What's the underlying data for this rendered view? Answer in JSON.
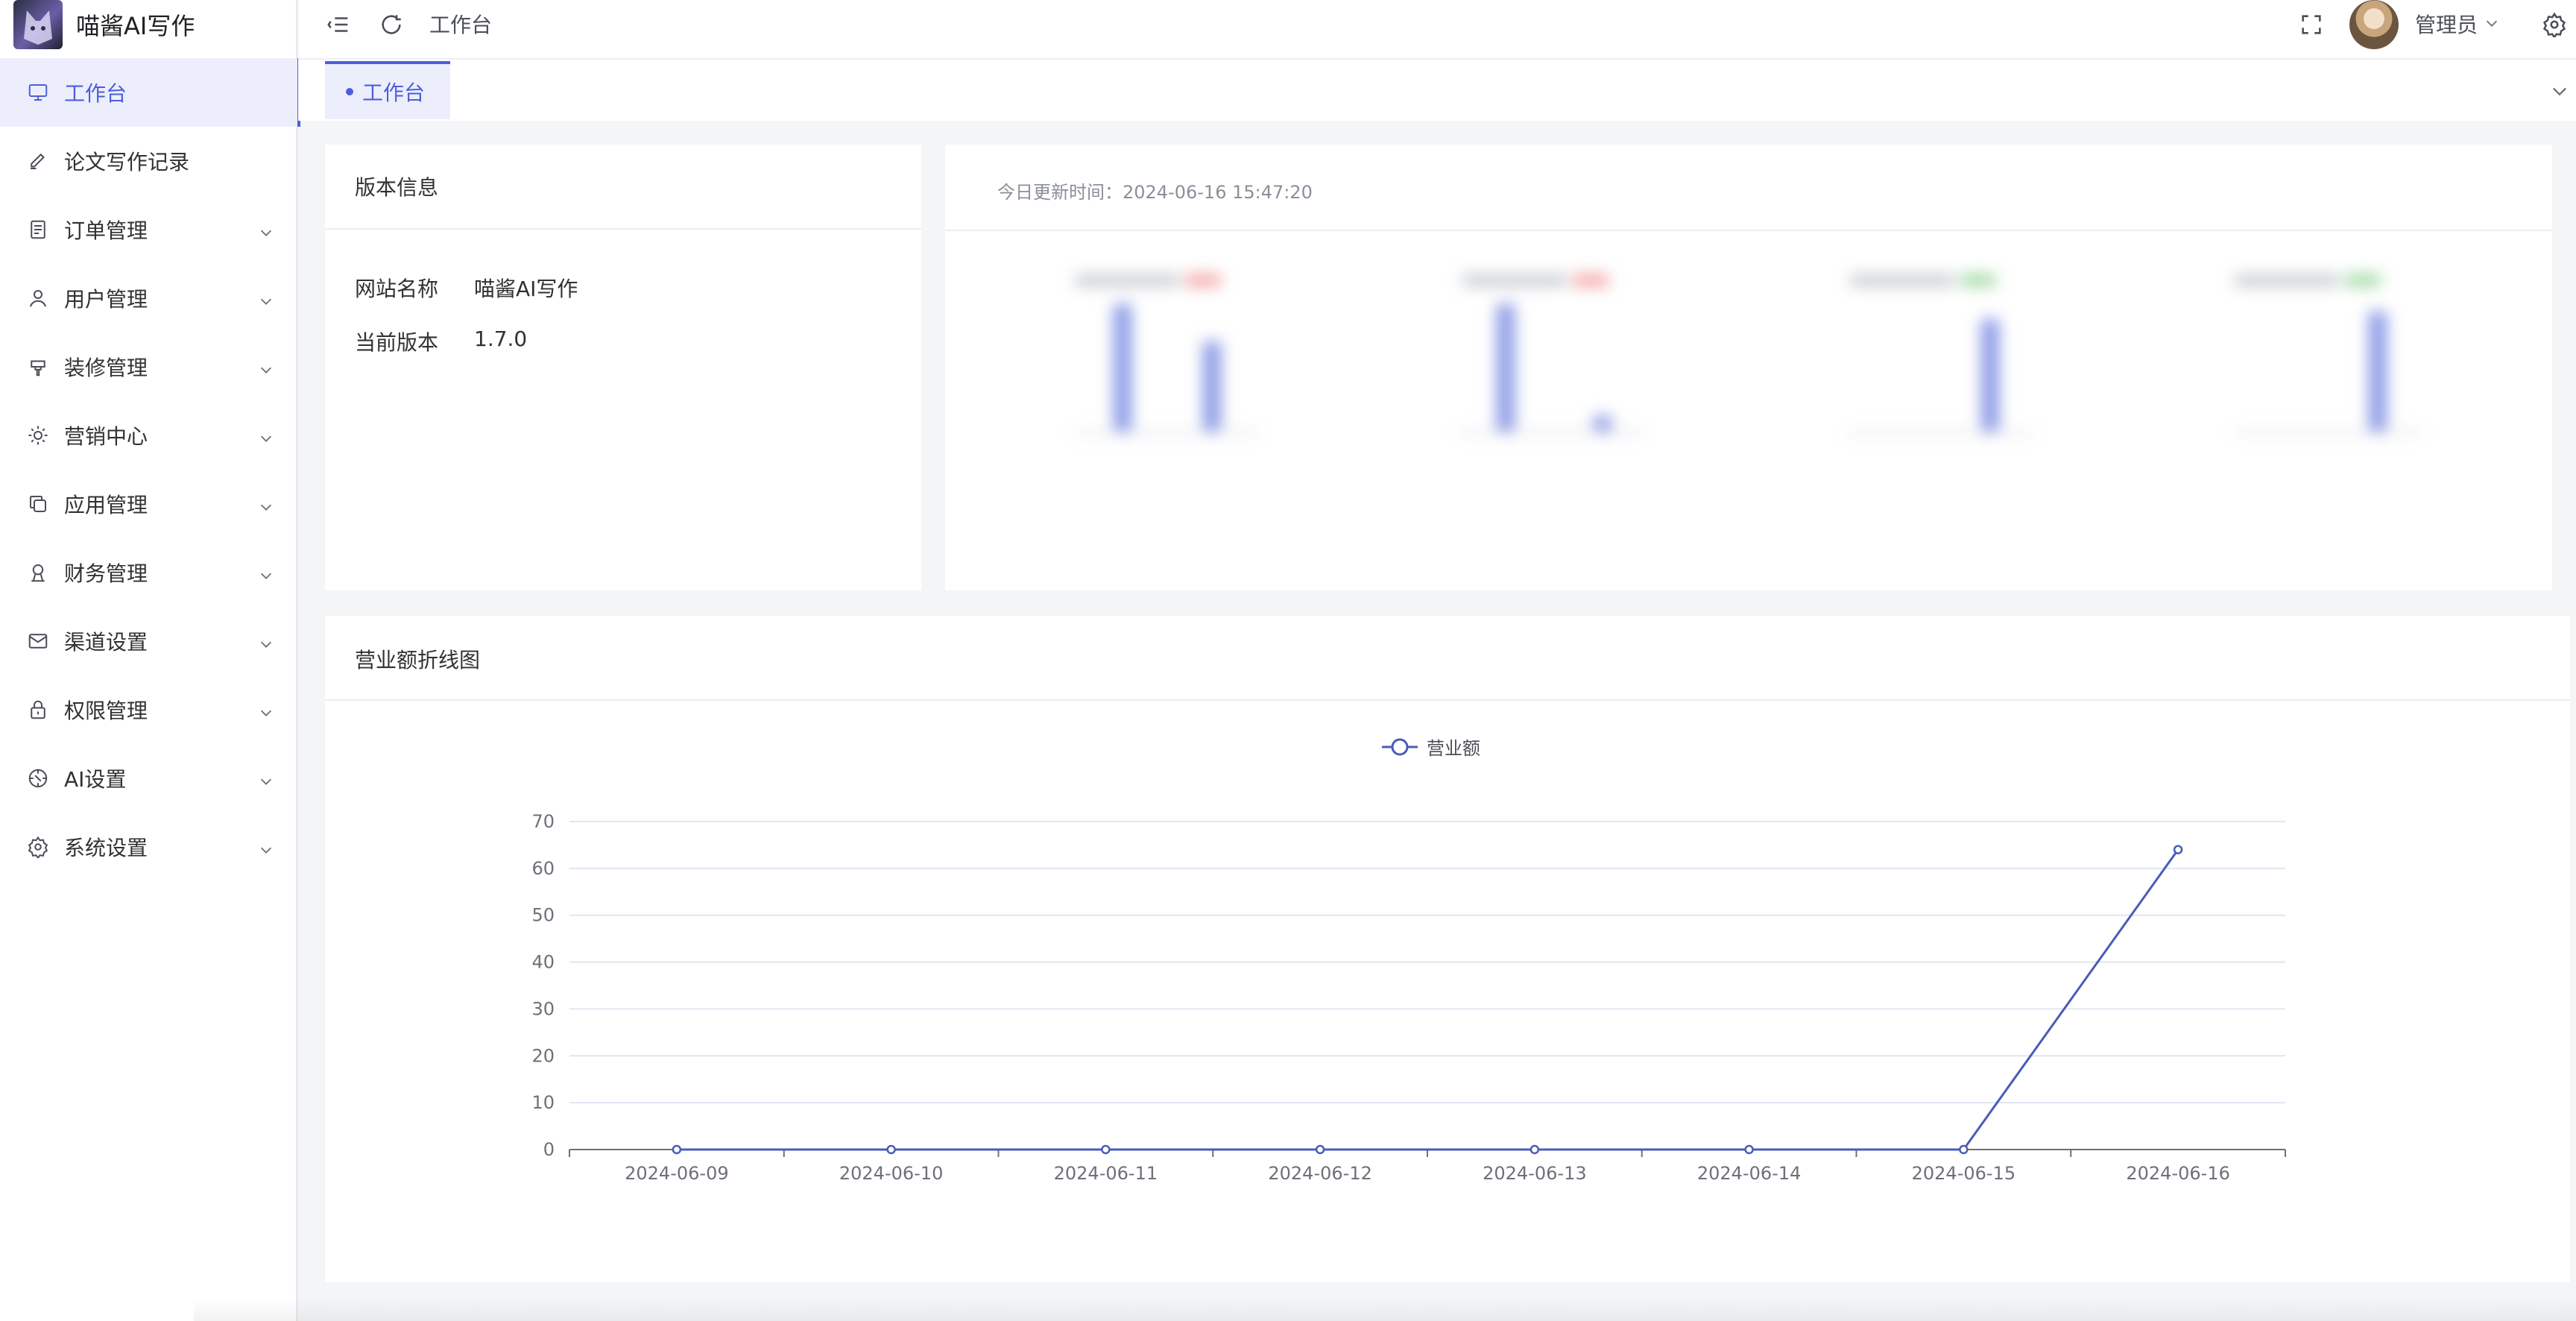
{
  "app": {
    "title": "喵酱AI写作"
  },
  "sidebar": {
    "items": [
      {
        "label": "工作台",
        "icon": "monitor-icon",
        "active": true,
        "chevron": false
      },
      {
        "label": "论文写作记录",
        "icon": "edit-pen-icon",
        "active": false,
        "chevron": false
      },
      {
        "label": "订单管理",
        "icon": "document-icon",
        "active": false,
        "chevron": true
      },
      {
        "label": "用户管理",
        "icon": "user-icon",
        "active": false,
        "chevron": true
      },
      {
        "label": "装修管理",
        "icon": "brush-icon",
        "active": false,
        "chevron": true
      },
      {
        "label": "营销中心",
        "icon": "sun-icon",
        "active": false,
        "chevron": true
      },
      {
        "label": "应用管理",
        "icon": "copy-icon",
        "active": false,
        "chevron": true
      },
      {
        "label": "财务管理",
        "icon": "finance-icon",
        "active": false,
        "chevron": true
      },
      {
        "label": "渠道设置",
        "icon": "mail-icon",
        "active": false,
        "chevron": true
      },
      {
        "label": "权限管理",
        "icon": "lock-icon",
        "active": false,
        "chevron": true
      },
      {
        "label": "AI设置",
        "icon": "compass-icon",
        "active": false,
        "chevron": true
      },
      {
        "label": "系统设置",
        "icon": "gear-icon",
        "active": false,
        "chevron": true
      }
    ]
  },
  "header": {
    "breadcrumb": "工作台",
    "user": {
      "name": "管理员"
    }
  },
  "tabs": [
    {
      "label": "工作台",
      "active": true
    }
  ],
  "version_card": {
    "title": "版本信息",
    "rows": [
      {
        "key": "网站名称",
        "value": "喵酱AI写作"
      },
      {
        "key": "当前版本",
        "value": "1.7.0"
      }
    ]
  },
  "stats_card": {
    "update_time": "今日更新时间：2024-06-16 15:47:20"
  },
  "line_card": {
    "title": "营业额折线图"
  },
  "colors": {
    "accent": "#4d5fd8",
    "line": "#4a5cb8",
    "blurred_bar": "#8b9ae6"
  },
  "chart_data": {
    "type": "line",
    "legend_position": "top-center",
    "grid": true,
    "series": [
      {
        "name": "营业额",
        "values": [
          0,
          0,
          0,
          0,
          0,
          0,
          0,
          64
        ]
      }
    ],
    "x": [
      "2024-06-09",
      "2024-06-10",
      "2024-06-11",
      "2024-06-12",
      "2024-06-13",
      "2024-06-14",
      "2024-06-15",
      "2024-06-16"
    ],
    "ylim": [
      0,
      70
    ],
    "yticks": [
      0,
      10,
      20,
      30,
      40,
      50,
      60,
      70
    ]
  }
}
